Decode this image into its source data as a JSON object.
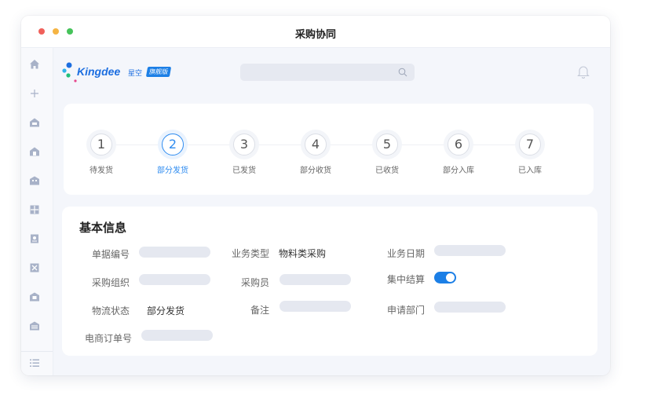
{
  "window": {
    "title": "采购协同"
  },
  "sidebar": {
    "icons": [
      "home-icon",
      "plus-icon",
      "building-icon",
      "building-icon",
      "building-icon",
      "grid-icon",
      "document-icon",
      "box-icon",
      "bank-icon",
      "bank-icon"
    ],
    "bottom_icon": "list-menu-icon"
  },
  "header": {
    "logo_text": "Kingdee",
    "logo_sub": "星空",
    "logo_badge": "旗舰版",
    "search_placeholder": "",
    "bell_icon": "bell-icon"
  },
  "steps": [
    {
      "number": "1",
      "label": "待发货",
      "active": false
    },
    {
      "number": "2",
      "label": "部分发货",
      "active": true
    },
    {
      "number": "3",
      "label": "已发货",
      "active": false
    },
    {
      "number": "4",
      "label": "部分收货",
      "active": false
    },
    {
      "number": "5",
      "label": "已收货",
      "active": false
    },
    {
      "number": "6",
      "label": "部分入库",
      "active": false
    },
    {
      "number": "7",
      "label": "已入库",
      "active": false
    }
  ],
  "basic_info": {
    "title": "基本信息",
    "fields": {
      "doc_no": {
        "label": "单据编号",
        "value": ""
      },
      "biz_type": {
        "label": "业务类型",
        "value": "物料类采购"
      },
      "biz_date": {
        "label": "业务日期",
        "value": ""
      },
      "purchase_org": {
        "label": "采购组织",
        "value": ""
      },
      "purchaser": {
        "label": "采购员",
        "value": ""
      },
      "central_settlement": {
        "label": "集中结算",
        "value": true
      },
      "logistics_status": {
        "label": "物流状态",
        "value": "部分发货"
      },
      "remark": {
        "label": "备注",
        "value": ""
      },
      "apply_dept": {
        "label": "申请部门",
        "value": ""
      },
      "ecommerce_order_no": {
        "label": "电商订单号",
        "value": ""
      }
    }
  },
  "colors": {
    "accent": "#2f8cf0",
    "brand": "#1c6ee0"
  }
}
